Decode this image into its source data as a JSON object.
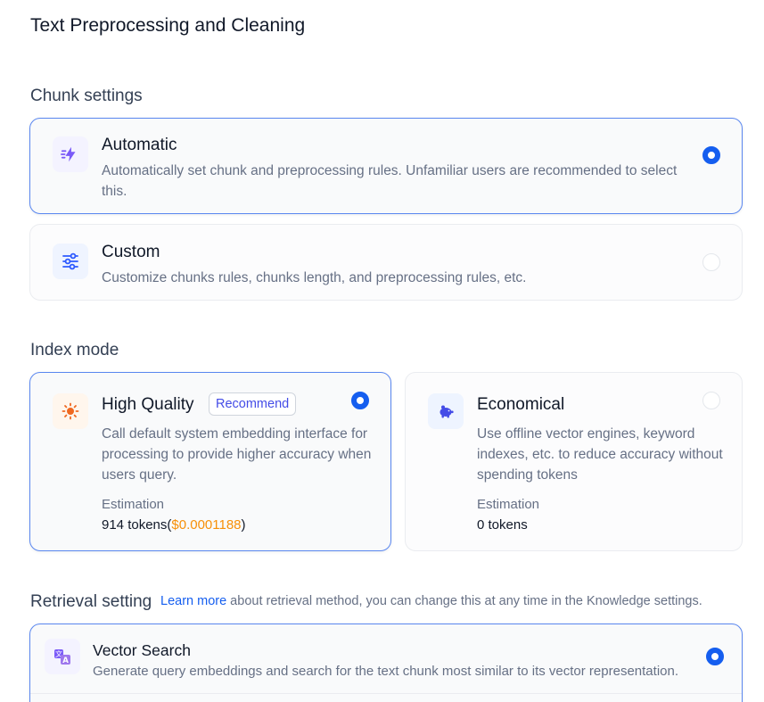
{
  "page": {
    "title": "Text Preprocessing and Cleaning"
  },
  "chunk_settings": {
    "title": "Chunk settings",
    "options": [
      {
        "title": "Automatic",
        "description": "Automatically set chunk and preprocessing rules. Unfamiliar users are recommended to select this.",
        "icon": "lightning-icon",
        "selected": true
      },
      {
        "title": "Custom",
        "description": "Customize chunks rules, chunks length, and preprocessing rules, etc.",
        "icon": "sliders-icon",
        "selected": false
      }
    ]
  },
  "index_mode": {
    "title": "Index mode",
    "high_quality": {
      "title": "High Quality",
      "badge": "Recommend",
      "description": "Call default system embedding interface for processing to provide higher accuracy when users query.",
      "estimation_label": "Estimation",
      "tokens": "914 tokens(",
      "price": "$0.0001188",
      "tokens_close": ")",
      "icon": "sun-icon",
      "selected": true
    },
    "economical": {
      "title": "Economical",
      "description": "Use offline vector engines, keyword indexes, etc. to reduce accuracy without spending tokens",
      "estimation_label": "Estimation",
      "tokens": "0 tokens",
      "icon": "piggy-bank-icon",
      "selected": false
    }
  },
  "retrieval_setting": {
    "title": "Retrieval setting",
    "link_text": "Learn more",
    "description": " about retrieval method, you can change this at any time in the Knowledge settings.",
    "vector_search": {
      "title": "Vector Search",
      "description": "Generate query embeddings and search for the text chunk most similar to its vector representation.",
      "icon": "translate-icon",
      "selected": true
    }
  },
  "colors": {
    "accent": "#155eef",
    "price": "#f79009",
    "badge": "#444ce7",
    "active_border": "#5a87f0"
  }
}
